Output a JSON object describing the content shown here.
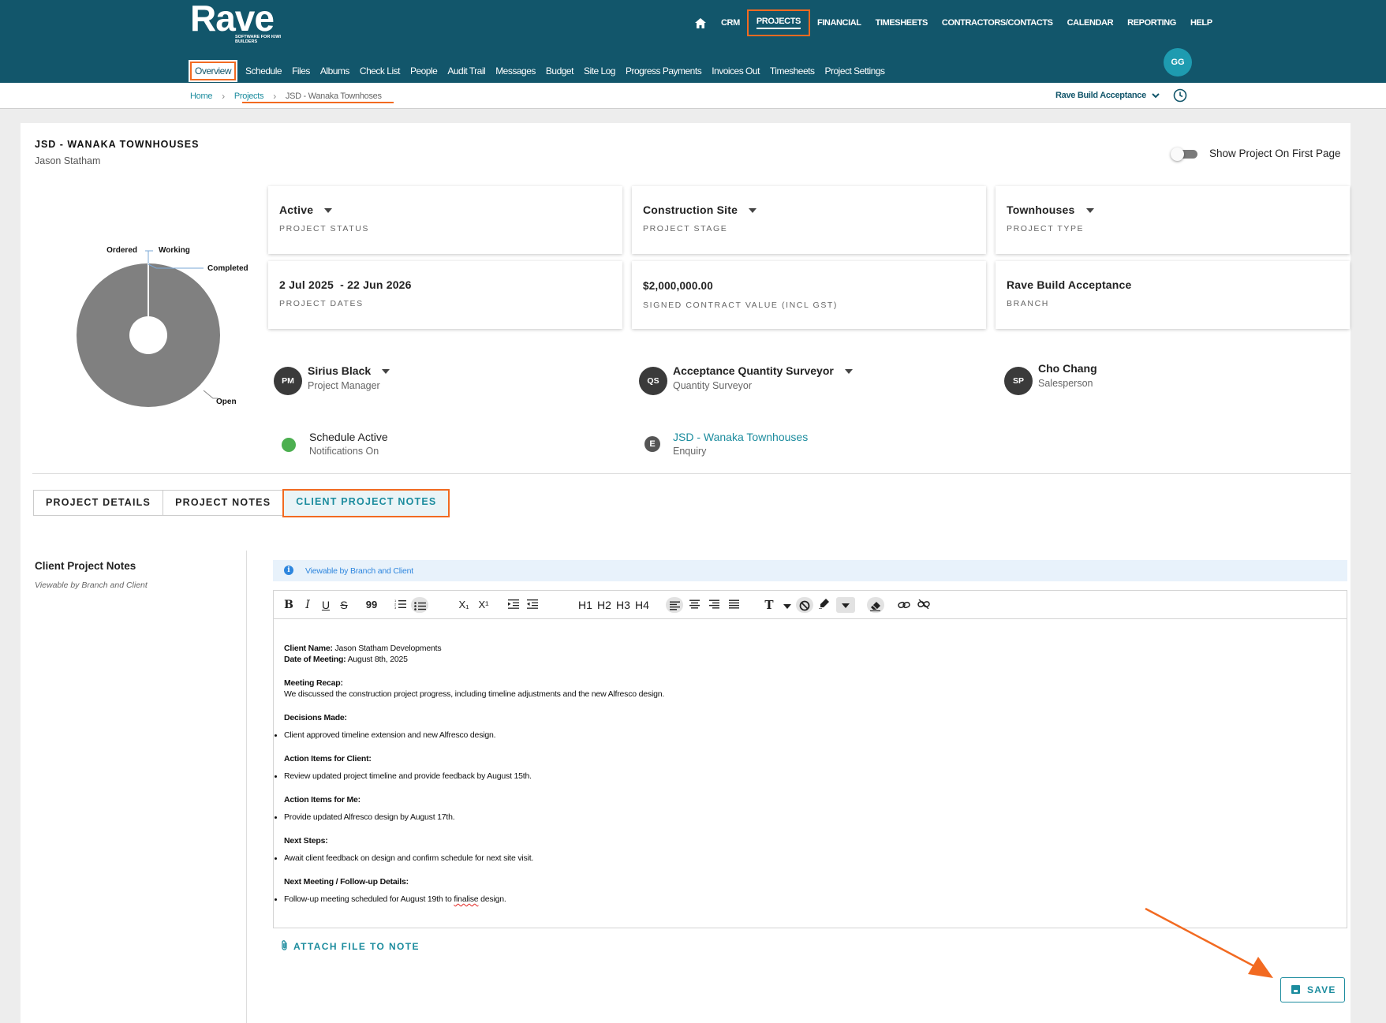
{
  "app": {
    "logo_word": "Rave",
    "logo_tagline": "SOFTWARE FOR KIWI BUILDERS"
  },
  "top_nav": [
    "CRM",
    "PROJECTS",
    "FINANCIAL",
    "TIMESHEETS",
    "CONTRACTORS/CONTACTS",
    "CALENDAR",
    "REPORTING",
    "HELP"
  ],
  "sub_nav": [
    "Overview",
    "Schedule",
    "Files",
    "Albums",
    "Check List",
    "People",
    "Audit Trail",
    "Messages",
    "Budget",
    "Site Log",
    "Progress Payments",
    "Invoices Out",
    "Timesheets",
    "Project Settings"
  ],
  "user_initials": "GG",
  "breadcrumb": {
    "home": "Home",
    "projects": "Projects",
    "current": "JSD - Wanaka Townhoses"
  },
  "branch_selector": "Rave Build Acceptance",
  "project": {
    "title": "JSD - WANAKA TOWNHOUSES",
    "owner": "Jason Statham",
    "show_first_page_label": "Show Project On First Page",
    "show_first_page_on": false
  },
  "chart_data": {
    "type": "pie",
    "labels": [
      "Ordered",
      "Working",
      "Completed",
      "Open"
    ],
    "values": [
      0,
      0,
      0,
      100
    ],
    "colors": {
      "slice": "#808080",
      "leader": "#7aa7d6"
    }
  },
  "info_boxes": [
    {
      "value": "Active",
      "caption": "PROJECT STATUS",
      "dropdown": true
    },
    {
      "value": "Construction Site",
      "caption": "PROJECT STAGE",
      "dropdown": true
    },
    {
      "value": "Townhouses",
      "caption": "PROJECT TYPE",
      "dropdown": true
    },
    {
      "value": "2 Jul 2025  - 22 Jun 2026",
      "caption": "PROJECT DATES",
      "dropdown": false
    },
    {
      "value": "$2,000,000.00",
      "caption": "SIGNED CONTRACT VALUE (INCL GST)",
      "dropdown": false
    },
    {
      "value": "Rave Build Acceptance",
      "caption": "BRANCH",
      "dropdown": false
    }
  ],
  "people": [
    {
      "initials": "PM",
      "name": "Sirius Black",
      "role": "Project Manager"
    },
    {
      "initials": "QS",
      "name": "Acceptance Quantity Surveyor",
      "role": "Quantity Surveyor"
    },
    {
      "initials": "SP",
      "name": "Cho Chang",
      "role": "Salesperson"
    }
  ],
  "schedule": {
    "title": "Schedule Active",
    "subtitle": "Notifications On",
    "color": "#4caf50"
  },
  "enquiry": {
    "badge": "E",
    "link": "JSD - Wanaka Townhouses",
    "subtitle": "Enquiry"
  },
  "tabs": [
    "PROJECT DETAILS",
    "PROJECT NOTES",
    "CLIENT PROJECT NOTES"
  ],
  "notes_panel": {
    "heading": "Client Project Notes",
    "subheading": "Viewable by Branch and Client",
    "banner": "Viewable by Branch and Client"
  },
  "toolbar": {
    "bold": "B",
    "italic": "I",
    "underline": "U",
    "strike": "S",
    "quote": "99",
    "sub": "X₁",
    "sup": "X¹",
    "h1": "H1",
    "h2": "H2",
    "h3": "H3",
    "h4": "H4",
    "text": "T"
  },
  "note_content": {
    "client_name_label": "Client Name:",
    "client_name": " Jason Statham Developments",
    "date_label": "Date of Meeting:",
    "date": " August 8th, 2025",
    "recap_label": "Meeting Recap:",
    "recap": "We discussed the construction project progress, including timeline adjustments and the new Alfresco design.",
    "decisions_label": "Decisions Made:",
    "decisions": "Client approved timeline extension and new Alfresco design.",
    "client_actions_label": "Action Items for Client:",
    "client_actions": "Review updated project timeline and provide feedback by August 15th.",
    "my_actions_label": "Action Items for Me:",
    "my_actions": "Provide updated Alfresco design by August 17th.",
    "next_steps_label": "Next Steps:",
    "next_steps": "Await client feedback on design and confirm schedule for next site visit.",
    "followup_label": "Next Meeting / Follow-up Details:",
    "followup_pre": "Follow-up meeting scheduled for August 19th to ",
    "followup_word": "finalise",
    "followup_post": " design."
  },
  "attach_label": "ATTACH FILE TO NOTE",
  "save_label": "SAVE",
  "accent_colors": {
    "brand": "#12566b",
    "link": "#1c8c9e",
    "highlight": "#f26a21"
  }
}
